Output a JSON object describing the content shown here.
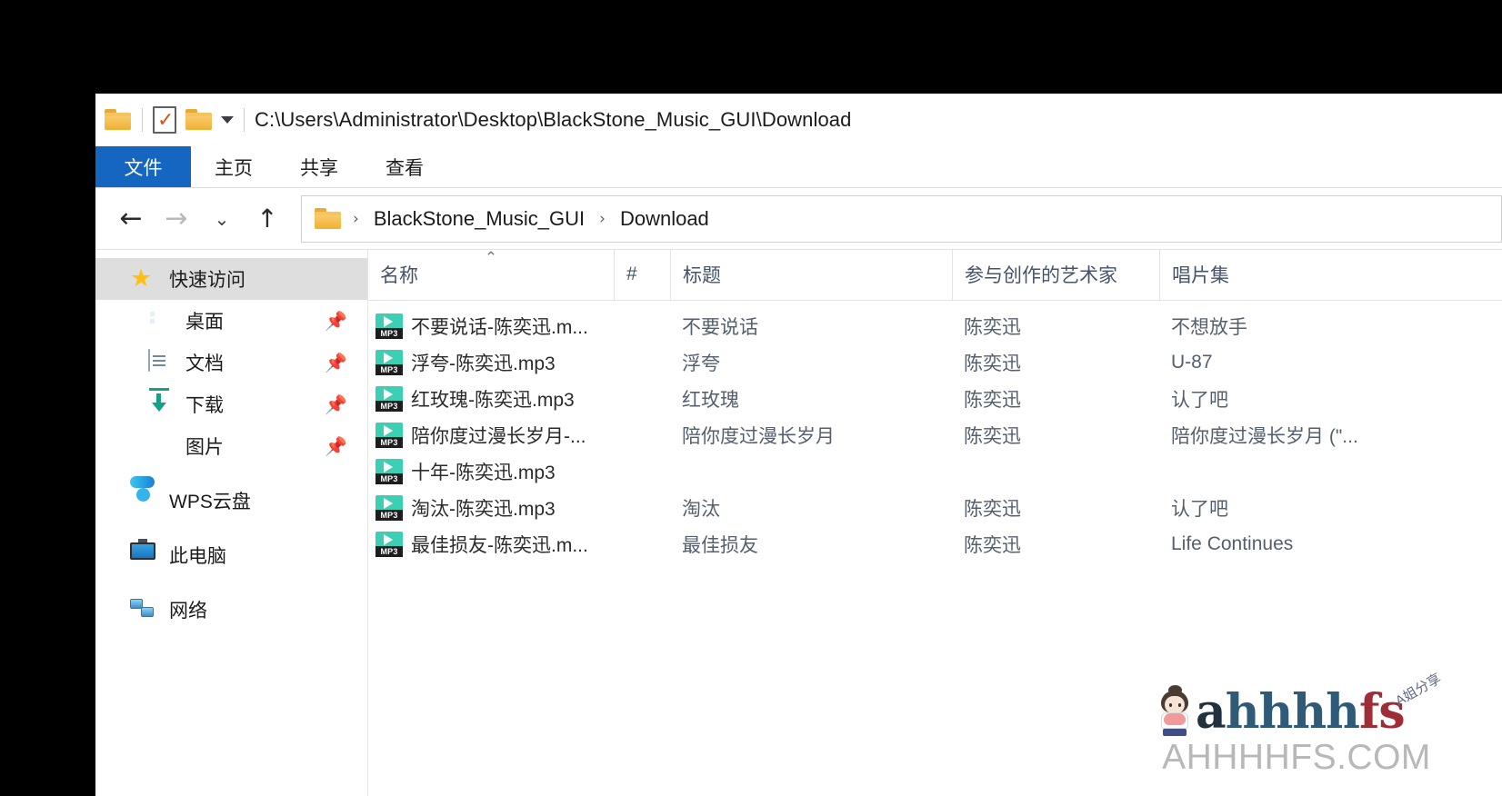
{
  "window": {
    "title_path": "C:\\Users\\Administrator\\Desktop\\BlackStone_Music_GUI\\Download"
  },
  "quick_access_toolbar": {
    "folder_icon": "folder-icon",
    "properties_icon": "properties-checkbox-icon",
    "new_folder_icon": "new-folder-icon",
    "customize_caret": "chevron-down-icon"
  },
  "ribbon": {
    "tabs": [
      {
        "label": "文件",
        "active": true
      },
      {
        "label": "主页",
        "active": false
      },
      {
        "label": "共享",
        "active": false
      },
      {
        "label": "查看",
        "active": false
      }
    ]
  },
  "navbar": {
    "back_icon": "←",
    "forward_icon": "→",
    "recent_icon": "⌄",
    "up_icon": "↑",
    "address_folder_icon": "folder-icon",
    "breadcrumbs": [
      "BlackStone_Music_GUI",
      "Download"
    ],
    "separator": "›"
  },
  "sidebar": {
    "items": [
      {
        "label": "快速访问",
        "icon": "star-icon",
        "selected": true,
        "pinned": false,
        "indented": false,
        "group": false
      },
      {
        "label": "桌面",
        "icon": "desktop-icon",
        "selected": false,
        "pinned": true,
        "indented": true,
        "group": false
      },
      {
        "label": "文档",
        "icon": "documents-icon",
        "selected": false,
        "pinned": true,
        "indented": true,
        "group": false
      },
      {
        "label": "下载",
        "icon": "download-icon",
        "selected": false,
        "pinned": true,
        "indented": true,
        "group": false
      },
      {
        "label": "图片",
        "icon": "pictures-icon",
        "selected": false,
        "pinned": true,
        "indented": true,
        "group": false
      },
      {
        "label": "WPS云盘",
        "icon": "cloud-icon",
        "selected": false,
        "pinned": false,
        "indented": false,
        "group": true
      },
      {
        "label": "此电脑",
        "icon": "this-pc-icon",
        "selected": false,
        "pinned": false,
        "indented": false,
        "group": true
      },
      {
        "label": "网络",
        "icon": "network-icon",
        "selected": false,
        "pinned": false,
        "indented": false,
        "group": true
      }
    ],
    "pin_glyph": "📌"
  },
  "filelist": {
    "columns": [
      {
        "key": "name",
        "label": "名称",
        "sorted": "asc"
      },
      {
        "key": "num",
        "label": "#",
        "sorted": ""
      },
      {
        "key": "title",
        "label": "标题",
        "sorted": ""
      },
      {
        "key": "artist",
        "label": "参与创作的艺术家",
        "sorted": ""
      },
      {
        "key": "album",
        "label": "唱片集",
        "sorted": ""
      }
    ],
    "sort_ascending_glyph": "⌃",
    "rows": [
      {
        "icon": "mp3-file-icon",
        "name": "不要说话-陈奕迅.m...",
        "num": "",
        "title": "不要说话",
        "artist": "陈奕迅",
        "album": "不想放手"
      },
      {
        "icon": "mp3-file-icon",
        "name": "浮夸-陈奕迅.mp3",
        "num": "",
        "title": "浮夸",
        "artist": "陈奕迅",
        "album": "U-87"
      },
      {
        "icon": "mp3-file-icon",
        "name": "红玫瑰-陈奕迅.mp3",
        "num": "",
        "title": "红玫瑰",
        "artist": "陈奕迅",
        "album": "认了吧"
      },
      {
        "icon": "mp3-file-icon",
        "name": "陪你度过漫长岁月-...",
        "num": "",
        "title": "陪你度过漫长岁月",
        "artist": "陈奕迅",
        "album": "陪你度过漫长岁月 (\"..."
      },
      {
        "icon": "mp3-file-icon",
        "name": "十年-陈奕迅.mp3",
        "num": "",
        "title": "",
        "artist": "",
        "album": ""
      },
      {
        "icon": "mp3-file-icon",
        "name": "淘汰-陈奕迅.mp3",
        "num": "",
        "title": "淘汰",
        "artist": "陈奕迅",
        "album": "认了吧"
      },
      {
        "icon": "mp3-file-icon",
        "name": "最佳损友-陈奕迅.m...",
        "num": "",
        "title": "最佳损友",
        "artist": "陈奕迅",
        "album": "Life Continues"
      }
    ],
    "mp3_badge": "MP3"
  },
  "watermark": {
    "logo_parts": [
      {
        "text": "a",
        "tone": "dark"
      },
      {
        "text": "hhhh",
        "tone": "blue"
      },
      {
        "text": "f",
        "tone": "red"
      },
      {
        "text": "s",
        "tone": "red"
      }
    ],
    "badge": "A姐分享",
    "site": "AHHHHFS.COM",
    "mascot": "girl-mascot-icon"
  },
  "colors": {
    "file_tab_blue": "#1566c0",
    "selected_nav": "#dedede",
    "column_header_text": "#44546a",
    "mp3_icon_green": "#3bcfb4",
    "folder_yellow": "#f0b032"
  }
}
